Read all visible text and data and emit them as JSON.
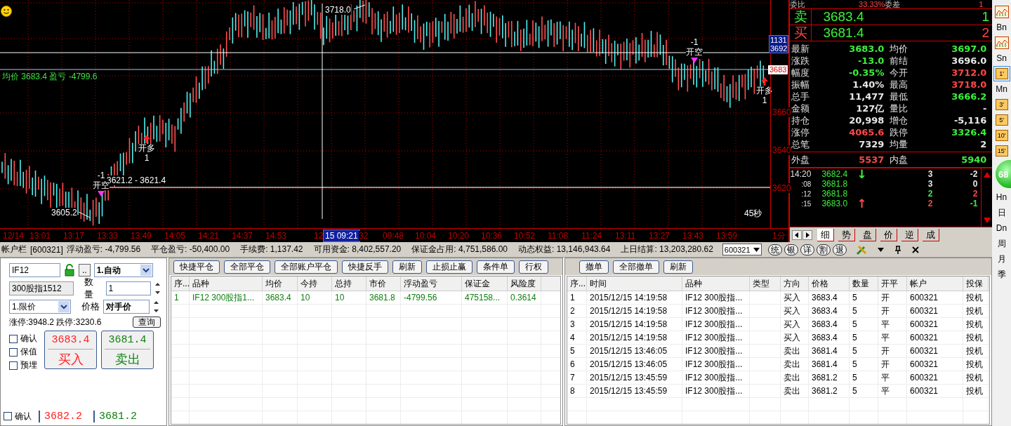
{
  "chart": {
    "avg_label": "均价 3683.4 盈亏 -4799.6",
    "high_label": "3718.0",
    "low_label": "3605.2",
    "range_label": "3621.2 - 3621.4",
    "countdown": "45秒",
    "period": "1分",
    "y_labels": [
      "3660",
      "3640",
      "3620"
    ],
    "price_tags": [
      "1131",
      "3692"
    ],
    "last_price_tag": "3683",
    "x_labels": [
      {
        "text": "12/14",
        "kind": "tick"
      },
      {
        "text": "13:01",
        "kind": "tick"
      },
      {
        "text": "13:17",
        "kind": "tick"
      },
      {
        "text": "13:33",
        "kind": "tick"
      },
      {
        "text": "13:49",
        "kind": "tick"
      },
      {
        "text": "14:05",
        "kind": "tick"
      },
      {
        "text": "14:21",
        "kind": "tick"
      },
      {
        "text": "14:37",
        "kind": "tick"
      },
      {
        "text": "14:53",
        "kind": "tick"
      },
      {
        "text": "12",
        "kind": "tick"
      },
      {
        "text": "15 09:21",
        "kind": "cursor"
      },
      {
        "text": "32",
        "kind": "tick"
      },
      {
        "text": "09:48",
        "kind": "tick"
      },
      {
        "text": "10:04",
        "kind": "tick"
      },
      {
        "text": "10:20",
        "kind": "tick"
      },
      {
        "text": "10:36",
        "kind": "tick"
      },
      {
        "text": "10:52",
        "kind": "tick"
      },
      {
        "text": "11:08",
        "kind": "tick"
      },
      {
        "text": "11:24",
        "kind": "tick"
      },
      {
        "text": "13:11",
        "kind": "tick"
      },
      {
        "text": "13:27",
        "kind": "tick"
      },
      {
        "text": "13:43",
        "kind": "tick"
      },
      {
        "text": "13:59",
        "kind": "tick"
      }
    ],
    "markers": [
      {
        "kind": "sell",
        "qty": "-1",
        "label": "开空"
      },
      {
        "kind": "buy",
        "qty": "1",
        "label": "开多"
      },
      {
        "kind": "sell",
        "qty": "-1",
        "label": "开空"
      },
      {
        "kind": "buy",
        "qty": "1",
        "label": "开多"
      }
    ]
  },
  "quote": {
    "top_row": [
      "委比",
      "33.33%",
      "委差",
      "1"
    ],
    "levels": [
      {
        "color": "#3cf03c",
        "label": "卖",
        "price": "3683.4",
        "volume": "1"
      },
      {
        "color": "#ff4848",
        "label": "买",
        "price": "3681.4",
        "volume": "2"
      }
    ],
    "stats": [
      {
        "label": "最新",
        "value": "3683.0",
        "color": "#3cf03c"
      },
      {
        "label": "均价",
        "value": "3697.0",
        "color": "#3cf03c"
      },
      {
        "label": "涨跌",
        "value": "-13.0",
        "color": "#3cf03c"
      },
      {
        "label": "前结",
        "value": "3696.0",
        "color": "#e8e8e8"
      },
      {
        "label": "幅度",
        "value": "-0.35%",
        "color": "#3cf03c"
      },
      {
        "label": "今开",
        "value": "3712.0",
        "color": "#ff4848"
      },
      {
        "label": "振幅",
        "value": "1.40%",
        "color": "#e8e8e8"
      },
      {
        "label": "最高",
        "value": "3718.0",
        "color": "#ff4848"
      },
      {
        "label": "总手",
        "value": "11,477",
        "color": "#e8e8e8"
      },
      {
        "label": "最低",
        "value": "3666.2",
        "color": "#3cf03c"
      },
      {
        "label": "金额",
        "value": "127亿",
        "color": "#e8e8e8"
      },
      {
        "label": "量比",
        "value": "-",
        "color": "#e8e8e8"
      },
      {
        "label": "持仓",
        "value": "20,998",
        "color": "#e8e8e8"
      },
      {
        "label": "增仓",
        "value": "-5,116",
        "color": "#e8e8e8"
      },
      {
        "label": "涨停",
        "value": "4065.6",
        "color": "#ff4848"
      },
      {
        "label": "跌停",
        "value": "3326.4",
        "color": "#3cf03c"
      },
      {
        "label": "总笔",
        "value": "7329",
        "color": "#e8e8e8"
      },
      {
        "label": "均量",
        "value": "2",
        "color": "#e8e8e8"
      }
    ],
    "flow": [
      {
        "label": "外盘",
        "value": "5537",
        "color": "#ff4848"
      },
      {
        "label": "内盘",
        "value": "5940",
        "color": "#3cf03c"
      }
    ],
    "ticks": [
      {
        "time": "14:20",
        "price": "3682.4",
        "arrow": {
          "text": "↓",
          "color": "#3cf03c"
        },
        "volume": {
          "text": "3",
          "color": "#e8e8e8"
        },
        "change": {
          "text": "-2",
          "color": "#e8e8e8"
        }
      },
      {
        "time": ":08",
        "price": "3681.8",
        "volume": {
          "text": "3",
          "color": "#e8e8e8"
        },
        "change": {
          "text": "0",
          "color": "#e8e8e8"
        }
      },
      {
        "time": ":12",
        "price": "3681.8",
        "volume": {
          "text": "2",
          "color": "#3cf03c"
        },
        "change": {
          "text": "2",
          "color": "#ff4848"
        }
      },
      {
        "time": ":15",
        "price": "3683.0",
        "arrow": {
          "text": "↑",
          "color": "#ff4848"
        },
        "volume": {
          "text": "2",
          "color": "#ff4848"
        },
        "change": {
          "text": "-1",
          "color": "#3cf03c"
        }
      }
    ],
    "tabs": [
      {
        "label": "细",
        "selected": true
      },
      {
        "label": "势",
        "selected": false
      },
      {
        "label": "盘",
        "selected": false
      },
      {
        "label": "价",
        "selected": false
      },
      {
        "label": "逆",
        "selected": false
      },
      {
        "label": "成",
        "selected": false
      }
    ]
  },
  "side_toolbar": {
    "items": [
      {
        "kind": "icon"
      },
      {
        "kind": "text",
        "label": "Bn"
      },
      {
        "kind": "icon"
      },
      {
        "kind": "text",
        "label": "Sn"
      },
      {
        "kind": "period",
        "label": "1'",
        "selected": true
      },
      {
        "kind": "text",
        "label": "Mn"
      },
      {
        "kind": "period",
        "label": "3'",
        "selected": false
      },
      {
        "kind": "period",
        "label": "5'",
        "selected": false
      },
      {
        "kind": "period",
        "label": "10'",
        "selected": false
      },
      {
        "kind": "period",
        "label": "15'",
        "selected": false
      },
      {
        "kind": "ball",
        "label": "68"
      },
      {
        "kind": "text",
        "label": "Hn"
      },
      {
        "kind": "text",
        "label": "日"
      },
      {
        "kind": "text",
        "label": "Dn"
      },
      {
        "kind": "text",
        "label": "周"
      },
      {
        "kind": "text",
        "label": "月"
      },
      {
        "kind": "text",
        "label": "季"
      }
    ]
  },
  "account_bar": {
    "title": "帐户栏",
    "account": "[600321]",
    "items": [
      "浮动盈亏: -4,799.56",
      "平仓盈亏: -50,400.00",
      "手续费: 1,137.42",
      "可用资金: 8,402,557.20",
      "保证金占用: 4,751,586.00",
      "动态权益: 13,146,943.64",
      "上日结算: 13,203,280.62"
    ],
    "account_select": "600321",
    "buttons": [
      "统",
      "银",
      "详",
      "割",
      "退"
    ]
  },
  "order_panel": {
    "contract": "IF12",
    "more": "..",
    "open_mode": "1.自动",
    "name": "300股指1512",
    "qty_label": "数量",
    "qty": "1",
    "price_type": "1.限价",
    "price_label": "价格",
    "price": "对手价",
    "limits": "涨停:3948.2 跌停:3230.6",
    "query": "查询",
    "options": [
      {
        "label": "确认",
        "checked": false
      },
      {
        "label": "保值",
        "checked": false
      },
      {
        "label": "预埋",
        "checked": false
      }
    ],
    "buy": {
      "price": "3683.4",
      "label": "买入"
    },
    "sell": {
      "price": "3681.4",
      "label": "卖出"
    },
    "quick": {
      "label": "确认",
      "checked": false,
      "buy_price": "3682.2",
      "sell_price": "3681.2"
    }
  },
  "positions": {
    "toolbar": [
      "快捷平仓",
      "全部平仓",
      "全部账户平仓",
      "快捷反手",
      "刷新",
      "止损止赢",
      "条件单",
      "行权"
    ],
    "columns": [
      "序...",
      "品种",
      "均价",
      "今持",
      "总持",
      "市价",
      "浮动盈亏",
      "保证金",
      "风险度"
    ],
    "rows": [
      [
        "1",
        "IF12 300股指1...",
        "3683.4",
        "10",
        "10",
        "3681.8",
        "-4799.56",
        "475158...",
        "0.3614"
      ]
    ]
  },
  "orders": {
    "toolbar": [
      "撤单",
      "全部撤单",
      "刷新"
    ],
    "columns": [
      "序...",
      "时间",
      "品种",
      "类型",
      "方向",
      "价格",
      "数量",
      "开平",
      "帐户",
      "投保"
    ],
    "rows": [
      [
        "1",
        "2015/12/15 14:19:58",
        "IF12 300股指...",
        "",
        "买入",
        "3683.4",
        "5",
        "开",
        "600321",
        "投机"
      ],
      [
        "2",
        "2015/12/15 14:19:58",
        "IF12 300股指...",
        "",
        "买入",
        "3683.4",
        "5",
        "开",
        "600321",
        "投机"
      ],
      [
        "3",
        "2015/12/15 14:19:58",
        "IF12 300股指...",
        "",
        "买入",
        "3683.4",
        "5",
        "平",
        "600321",
        "投机"
      ],
      [
        "4",
        "2015/12/15 14:19:58",
        "IF12 300股指...",
        "",
        "买入",
        "3683.4",
        "5",
        "平",
        "600321",
        "投机"
      ],
      [
        "5",
        "2015/12/15 13:46:05",
        "IF12 300股指...",
        "",
        "卖出",
        "3681.4",
        "5",
        "开",
        "600321",
        "投机"
      ],
      [
        "6",
        "2015/12/15 13:46:05",
        "IF12 300股指...",
        "",
        "卖出",
        "3681.4",
        "5",
        "开",
        "600321",
        "投机"
      ],
      [
        "7",
        "2015/12/15 13:45:59",
        "IF12 300股指...",
        "",
        "卖出",
        "3681.2",
        "5",
        "平",
        "600321",
        "投机"
      ],
      [
        "8",
        "2015/12/15 13:45:59",
        "IF12 300股指...",
        "",
        "卖出",
        "3681.2",
        "5",
        "平",
        "600321",
        "投机"
      ]
    ]
  }
}
